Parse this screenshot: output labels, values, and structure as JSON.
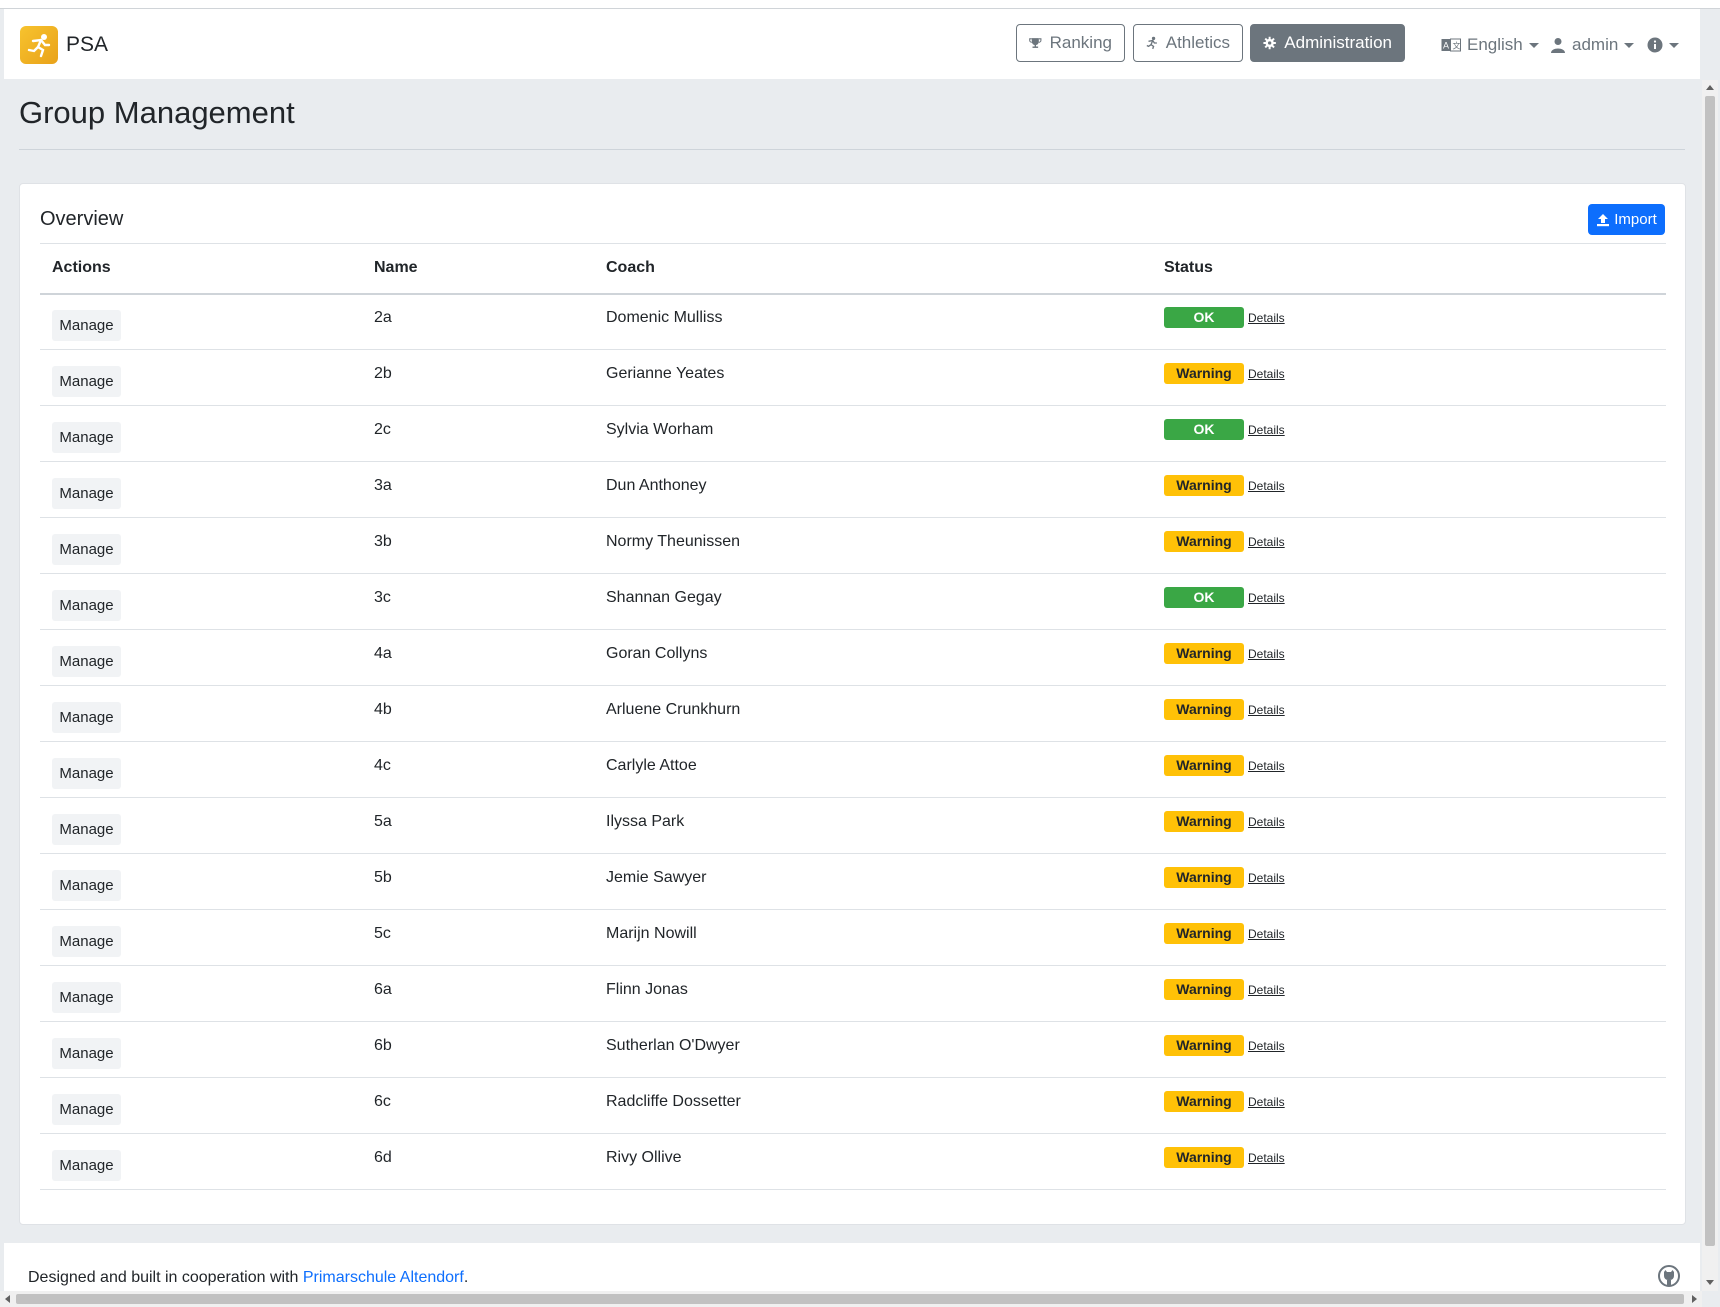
{
  "app": {
    "brand": "PSA"
  },
  "nav": {
    "ranking": "Ranking",
    "athletics": "Athletics",
    "administration": "Administration",
    "language": "English",
    "user": "admin"
  },
  "page": {
    "title": "Group Management"
  },
  "overview": {
    "title": "Overview",
    "import_label": "Import",
    "columns": [
      "Actions",
      "Name",
      "Coach",
      "Status"
    ],
    "manage_label": "Manage",
    "details_label": "Details",
    "rows": [
      {
        "name": "2a",
        "coach": "Domenic Mulliss",
        "status": "OK"
      },
      {
        "name": "2b",
        "coach": "Gerianne Yeates",
        "status": "Warning"
      },
      {
        "name": "2c",
        "coach": "Sylvia Worham",
        "status": "OK"
      },
      {
        "name": "3a",
        "coach": "Dun Anthoney",
        "status": "Warning"
      },
      {
        "name": "3b",
        "coach": "Normy Theunissen",
        "status": "Warning"
      },
      {
        "name": "3c",
        "coach": "Shannan Gegay",
        "status": "OK"
      },
      {
        "name": "4a",
        "coach": "Goran Collyns",
        "status": "Warning"
      },
      {
        "name": "4b",
        "coach": "Arluene Crunkhurn",
        "status": "Warning"
      },
      {
        "name": "4c",
        "coach": "Carlyle Attoe",
        "status": "Warning"
      },
      {
        "name": "5a",
        "coach": "Ilyssa Park",
        "status": "Warning"
      },
      {
        "name": "5b",
        "coach": "Jemie Sawyer",
        "status": "Warning"
      },
      {
        "name": "5c",
        "coach": "Marijn Nowill",
        "status": "Warning"
      },
      {
        "name": "6a",
        "coach": "Flinn Jonas",
        "status": "Warning"
      },
      {
        "name": "6b",
        "coach": "Sutherlan O'Dwyer",
        "status": "Warning"
      },
      {
        "name": "6c",
        "coach": "Radcliffe Dossetter",
        "status": "Warning"
      },
      {
        "name": "6d",
        "coach": "Rivy Ollive",
        "status": "Warning"
      }
    ]
  },
  "footer": {
    "text": "Designed and built in cooperation with ",
    "link": "Primarschule Altendorf",
    "suffix": "."
  },
  "colors": {
    "ok": "#3aa745",
    "warning": "#ffc107",
    "primary": "#0d6efd",
    "secondary": "#6c757d"
  },
  "icons": {
    "brand": "running-athlete-icon",
    "ranking": "trophy-icon",
    "athletics": "running-icon",
    "administration": "gear-icon",
    "language": "translate-icon",
    "user": "person-icon",
    "info": "info-icon",
    "import": "upload-icon",
    "footer": "github-icon"
  }
}
